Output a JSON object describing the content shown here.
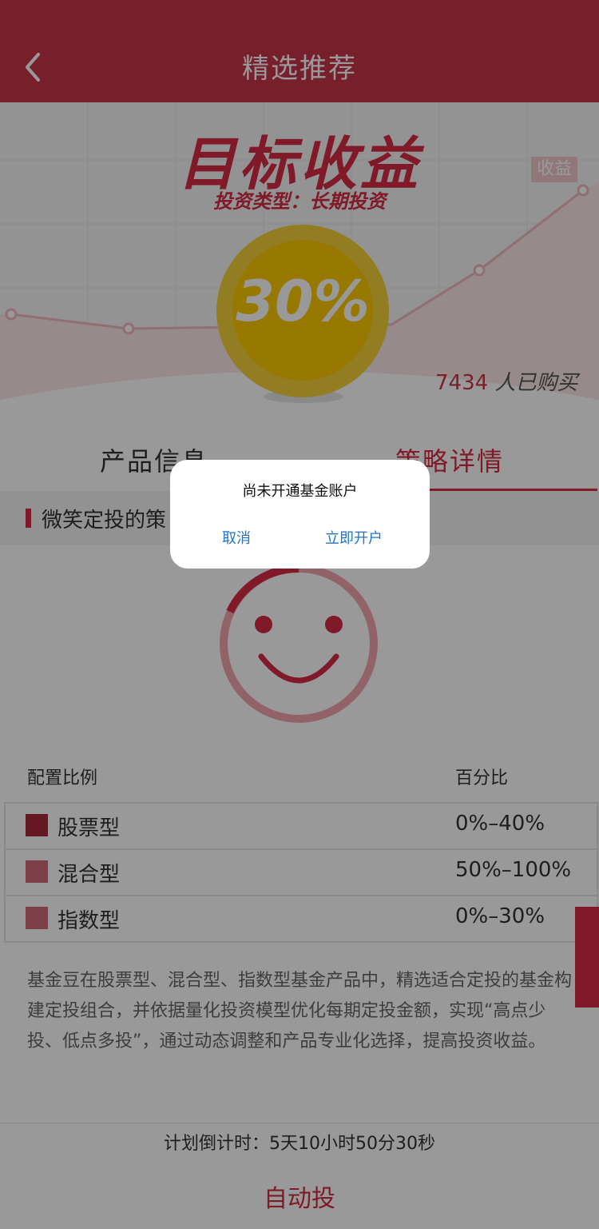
{
  "header": {
    "title": "精选推荐"
  },
  "hero": {
    "title": "目标收益",
    "subtitle": "投资类型：长期投资",
    "chart_tag": "收益",
    "rate": "30%",
    "buyers_count": "7434",
    "buyers_suffix": "人已购买"
  },
  "tabs": [
    {
      "label": "产品信息",
      "active": false
    },
    {
      "label": "策略详情",
      "active": true
    }
  ],
  "section": {
    "title": "微笑定投的策"
  },
  "allocation": {
    "header_left": "配置比例",
    "header_right": "百分比",
    "rows": [
      {
        "label": "股票型",
        "value": "0%–40%",
        "color": "#a8283c"
      },
      {
        "label": "混合型",
        "value": "50%–100%",
        "color": "#d06a78"
      },
      {
        "label": "指数型",
        "value": "0%–30%",
        "color": "#d06a78"
      }
    ]
  },
  "description": "基金豆在股票型、混合型、指数型基金产品中，精选适合定投的基金构建定投组合，并依据量化投资模型优化每期定投金额，实现“高点少投、低点多投”，通过动态调整和产品专业化选择，提高投资收益。",
  "countdown": "计划倒计时：5天10小时50分30秒",
  "bottom_button": "自动投",
  "modal": {
    "title": "尚未开通基金账户",
    "cancel": "取消",
    "confirm": "立即开户"
  },
  "colors": {
    "brand": "#c8354a",
    "link": "#1f74c9"
  }
}
